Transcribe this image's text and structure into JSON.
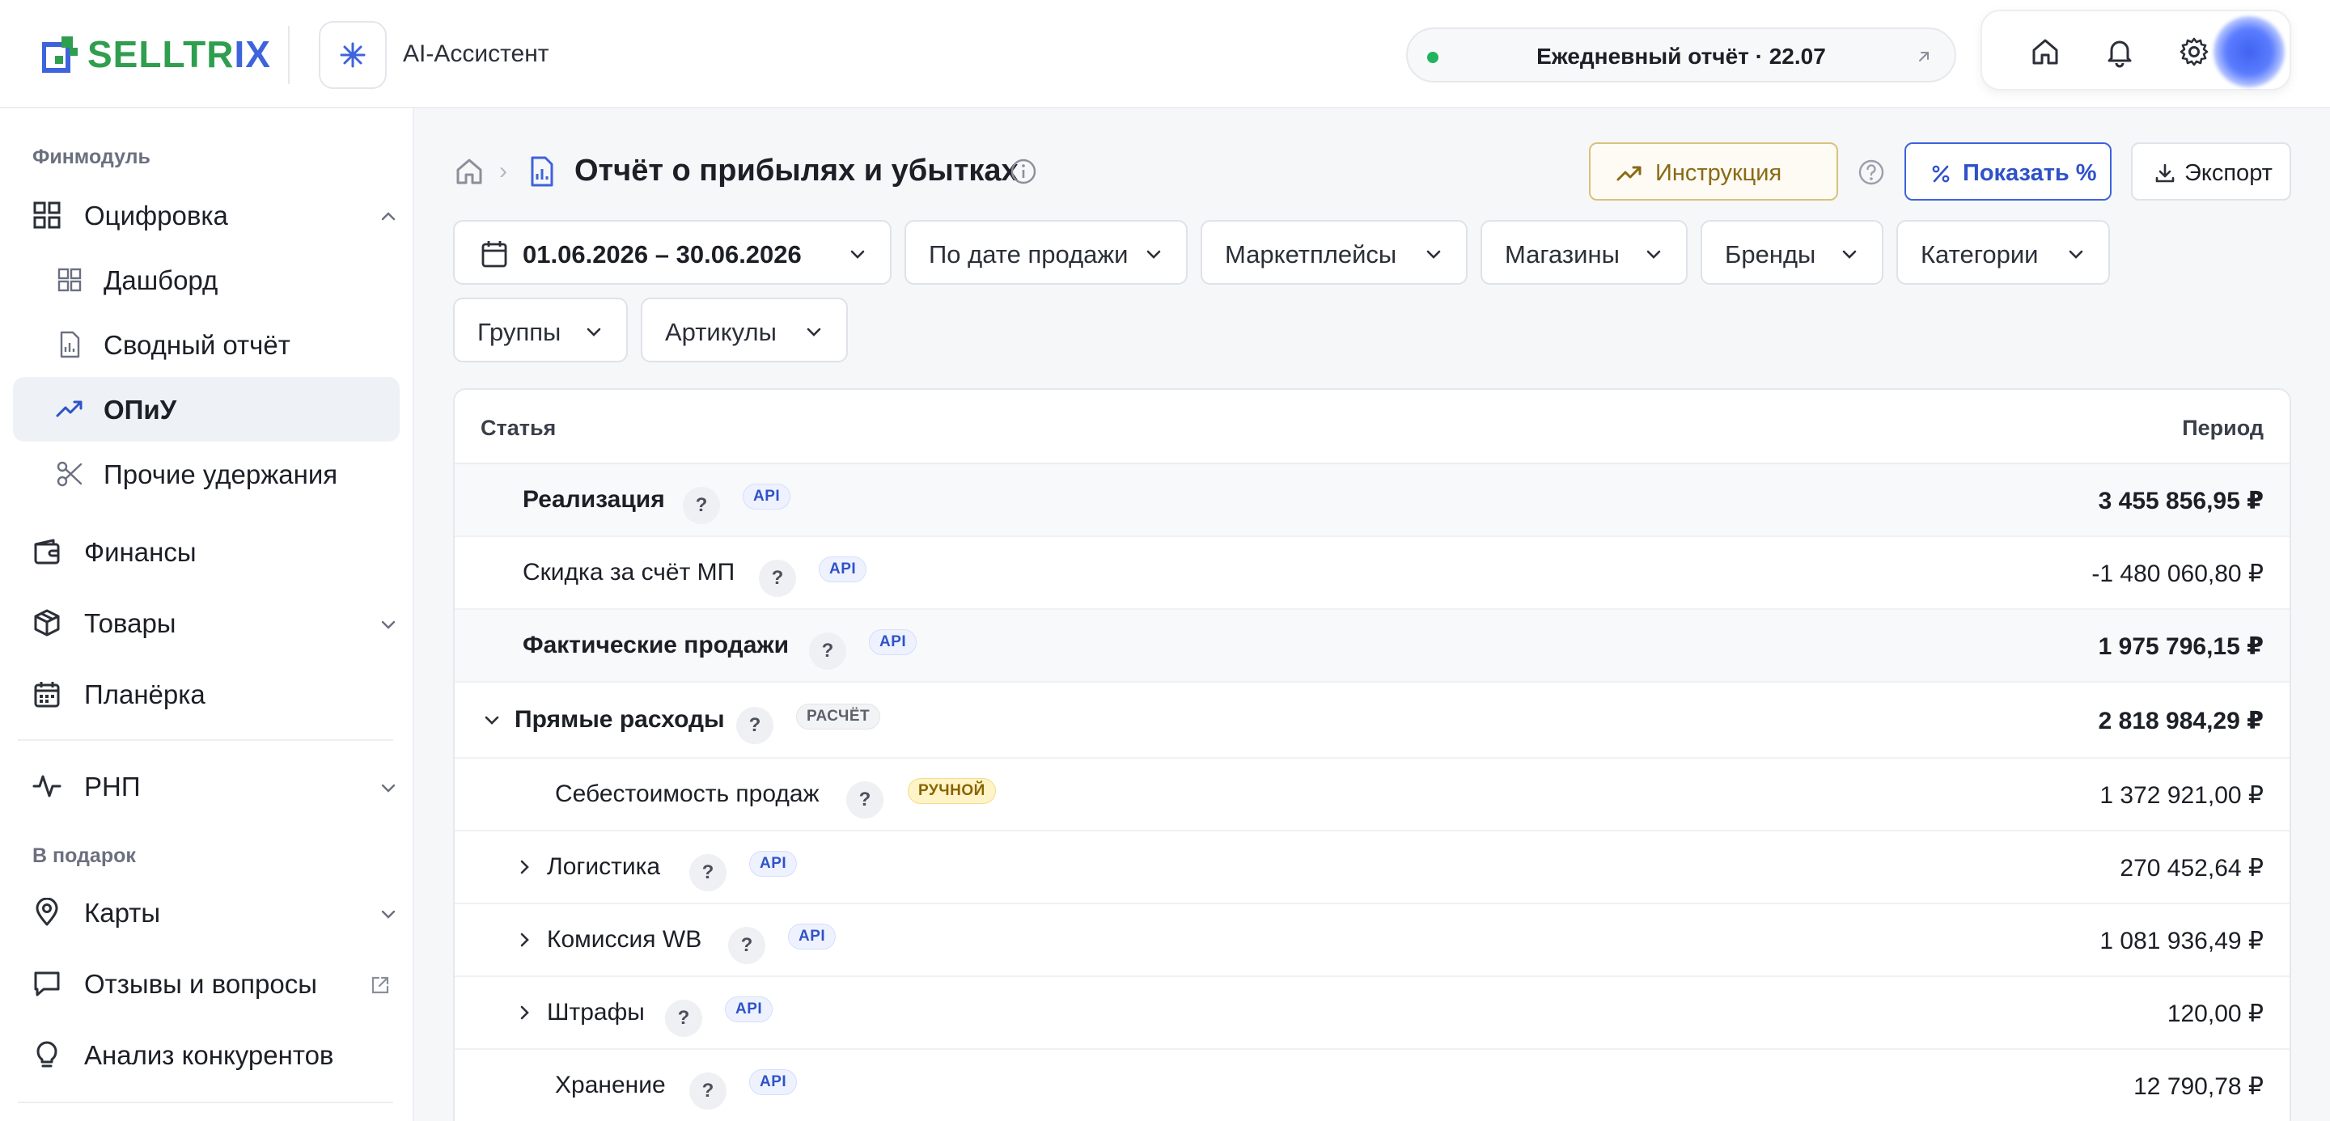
{
  "brand": {
    "logo_text_a": "SELLTR",
    "logo_text_b": "IX"
  },
  "header": {
    "assistant_label": "AI-Ассистент",
    "report_pill": "Ежедневный отчёт · 22.07"
  },
  "sidebar": {
    "section_finmodule": "Финмодуль",
    "section_gift": "В подарок",
    "items": {
      "digitization": "Оцифровка",
      "dashboard": "Дашборд",
      "summary": "Сводный отчёт",
      "pnl": "ОПиУ",
      "other": "Прочие удержания",
      "finance": "Финансы",
      "goods": "Товары",
      "planner": "Планёрка",
      "rnp": "РНП",
      "cards": "Карты",
      "reviews": "Отзывы и вопросы",
      "competitors": "Анализ конкурентов"
    }
  },
  "page": {
    "title": "Отчёт о прибылях и убытках",
    "btn_instruction": "Инструкция",
    "btn_percent": "Показать %",
    "btn_export": "Экспорт"
  },
  "filters": {
    "date_range": "01.06.2026 – 30.06.2026",
    "by_date": "По дате продажи",
    "marketplaces": "Маркетплейсы",
    "stores": "Магазины",
    "brands": "Бренды",
    "categories": "Категории",
    "groups": "Группы",
    "articles": "Артикулы"
  },
  "table": {
    "col_item": "Статья",
    "col_period": "Период",
    "help_mark": "?",
    "rows": [
      {
        "name": "Реализация",
        "tag": "API",
        "value": "3 455 856,95 ₽"
      },
      {
        "name": "Скидка за счёт МП",
        "tag": "API",
        "value": "-1 480 060,80 ₽"
      },
      {
        "name": "Фактические продажи",
        "tag": "API",
        "value": "1 975 796,15 ₽"
      },
      {
        "name": "Прямые расходы",
        "tag": "РАСЧЁТ",
        "value": "2 818 984,29 ₽"
      },
      {
        "name": "Себестоимость продаж",
        "tag": "РУЧНОЙ",
        "value": "1 372 921,00 ₽"
      },
      {
        "name": "Логистика",
        "tag": "API",
        "value": "270 452,64 ₽"
      },
      {
        "name": "Комиссия WB",
        "tag": "API",
        "value": "1 081 936,49 ₽"
      },
      {
        "name": "Штрафы",
        "tag": "API",
        "value": "120,00 ₽"
      },
      {
        "name": "Хранение",
        "tag": "API",
        "value": "12 790,78 ₽"
      }
    ]
  }
}
